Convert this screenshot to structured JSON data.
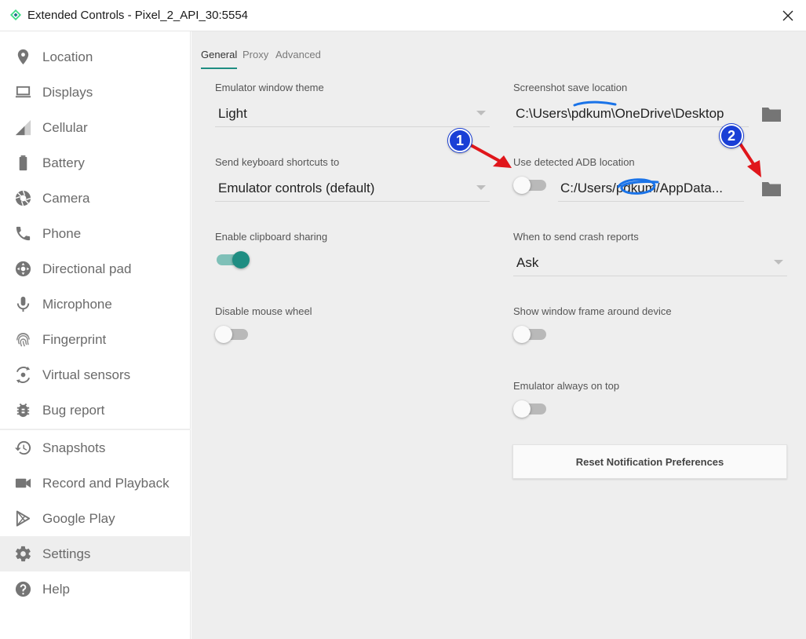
{
  "window": {
    "title": "Extended Controls - Pixel_2_API_30:5554"
  },
  "colors": {
    "accent": "#1f8d82",
    "badge": "#1a3fd6",
    "arrow": "#e0161b",
    "scribble": "#1a73e8"
  },
  "sidebar": {
    "items": [
      {
        "label": "Location",
        "icon": "location-pin-icon"
      },
      {
        "label": "Displays",
        "icon": "laptop-icon"
      },
      {
        "label": "Cellular",
        "icon": "signal-icon"
      },
      {
        "label": "Battery",
        "icon": "battery-icon"
      },
      {
        "label": "Camera",
        "icon": "camera-aperture-icon"
      },
      {
        "label": "Phone",
        "icon": "phone-icon"
      },
      {
        "label": "Directional pad",
        "icon": "dpad-icon"
      },
      {
        "label": "Microphone",
        "icon": "microphone-icon"
      },
      {
        "label": "Fingerprint",
        "icon": "fingerprint-icon"
      },
      {
        "label": "Virtual sensors",
        "icon": "rotate-sensor-icon"
      },
      {
        "label": "Bug report",
        "icon": "bug-icon"
      },
      {
        "label": "Snapshots",
        "icon": "history-icon"
      },
      {
        "label": "Record and Playback",
        "icon": "video-camera-icon"
      },
      {
        "label": "Google Play",
        "icon": "play-store-icon"
      },
      {
        "label": "Settings",
        "icon": "gear-icon"
      },
      {
        "label": "Help",
        "icon": "help-circle-icon"
      }
    ],
    "active": "Settings"
  },
  "tabs": [
    {
      "label": "General",
      "active": true
    },
    {
      "label": "Proxy",
      "active": false
    },
    {
      "label": "Advanced",
      "active": false
    }
  ],
  "settings": {
    "theme": {
      "label": "Emulator window theme",
      "value": "Light"
    },
    "shortcuts": {
      "label": "Send keyboard shortcuts to",
      "value": "Emulator controls (default)"
    },
    "clipboard": {
      "label": "Enable clipboard sharing",
      "on": true
    },
    "mouse_wheel": {
      "label": "Disable mouse wheel",
      "on": false
    },
    "screenshot": {
      "label": "Screenshot save location",
      "value": "C:\\Users\\pdkum\\OneDrive\\Desktop"
    },
    "adb": {
      "label": "Use detected ADB location",
      "on": false,
      "value": "C:/Users/pdkum/AppData..."
    },
    "crash": {
      "label": "When to send crash reports",
      "value": "Ask"
    },
    "window_frame": {
      "label": "Show window frame around device",
      "on": false
    },
    "always_on_top": {
      "label": "Emulator always on top",
      "on": false
    },
    "reset_button": "Reset Notification Preferences"
  },
  "annotations": [
    {
      "number": "1"
    },
    {
      "number": "2"
    }
  ]
}
